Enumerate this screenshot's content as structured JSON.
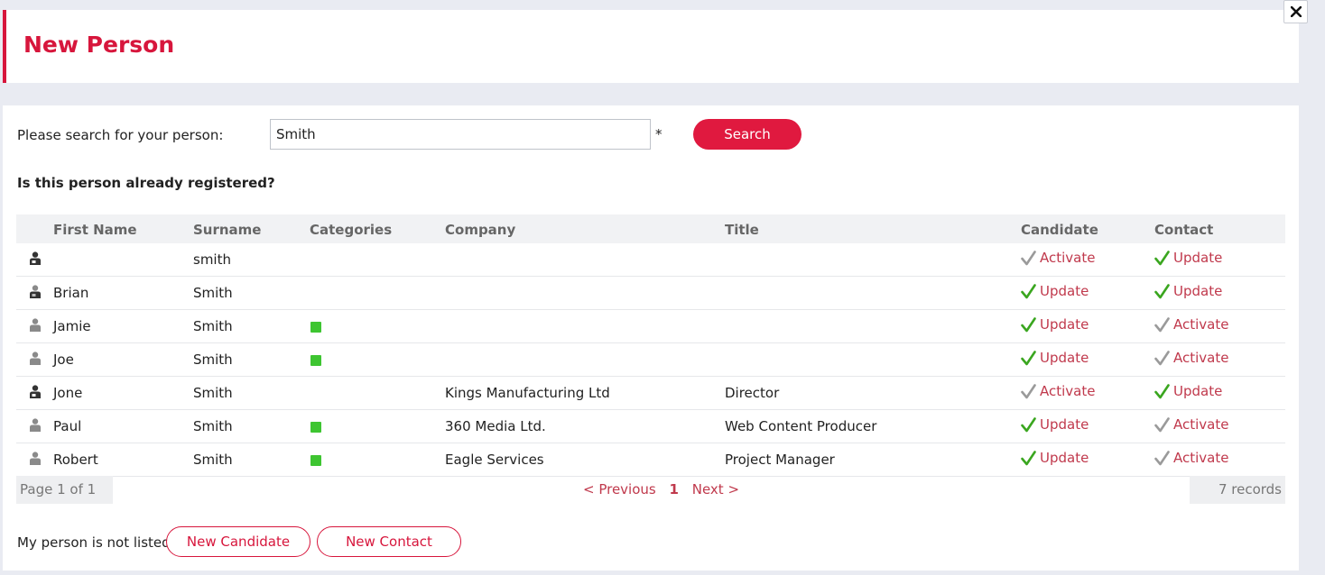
{
  "dialog": {
    "title": "New Person"
  },
  "search": {
    "label": "Please search for your person:",
    "value": "Smith",
    "required_mark": "*",
    "button_label": "Search"
  },
  "question": "Is this person already registered?",
  "table": {
    "headers": {
      "first_name": "First Name",
      "surname": "Surname",
      "categories": "Categories",
      "company": "Company",
      "title": "Title",
      "candidate": "Candidate",
      "contact": "Contact"
    },
    "rows": [
      {
        "icon": "person-dark-icon",
        "first_name": "",
        "surname": "smith",
        "category": false,
        "company": "",
        "title": "",
        "candidate": {
          "label": "Activate",
          "active": false
        },
        "contact": {
          "label": "Update",
          "active": true
        }
      },
      {
        "icon": "person-mixed-icon",
        "first_name": "Brian",
        "surname": "Smith",
        "category": false,
        "company": "",
        "title": "",
        "candidate": {
          "label": "Update",
          "active": true
        },
        "contact": {
          "label": "Update",
          "active": true
        }
      },
      {
        "icon": "person-light-icon",
        "first_name": "Jamie",
        "surname": "Smith",
        "category": true,
        "company": "",
        "title": "",
        "candidate": {
          "label": "Update",
          "active": true
        },
        "contact": {
          "label": "Activate",
          "active": false
        }
      },
      {
        "icon": "person-light-icon",
        "first_name": "Joe",
        "surname": "Smith",
        "category": true,
        "company": "",
        "title": "",
        "candidate": {
          "label": "Update",
          "active": true
        },
        "contact": {
          "label": "Activate",
          "active": false
        }
      },
      {
        "icon": "person-dark-icon",
        "first_name": "Jone",
        "surname": "Smith",
        "category": false,
        "company": "Kings Manufacturing Ltd",
        "title": "Director",
        "candidate": {
          "label": "Activate",
          "active": false
        },
        "contact": {
          "label": "Update",
          "active": true
        }
      },
      {
        "icon": "person-light-icon",
        "first_name": "Paul",
        "surname": "Smith",
        "category": true,
        "company": "360 Media Ltd.",
        "title": "Web Content Producer",
        "candidate": {
          "label": "Update",
          "active": true
        },
        "contact": {
          "label": "Activate",
          "active": false
        }
      },
      {
        "icon": "person-light-icon",
        "first_name": "Robert",
        "surname": "Smith",
        "category": true,
        "company": "Eagle Services",
        "title": "Project Manager",
        "candidate": {
          "label": "Update",
          "active": true
        },
        "contact": {
          "label": "Activate",
          "active": false
        }
      }
    ]
  },
  "pagination": {
    "page_info": "Page 1 of 1",
    "previous": "< Previous",
    "current": "1",
    "next": "Next >",
    "records": "7 records"
  },
  "not_listed": {
    "label": "My person is not listed:",
    "new_candidate": "New Candidate",
    "new_contact": "New Contact"
  },
  "colors": {
    "accent": "#d7163c",
    "check_active": "#3aa61f",
    "check_inactive": "#9a9a9a",
    "category": "#3ec531"
  }
}
